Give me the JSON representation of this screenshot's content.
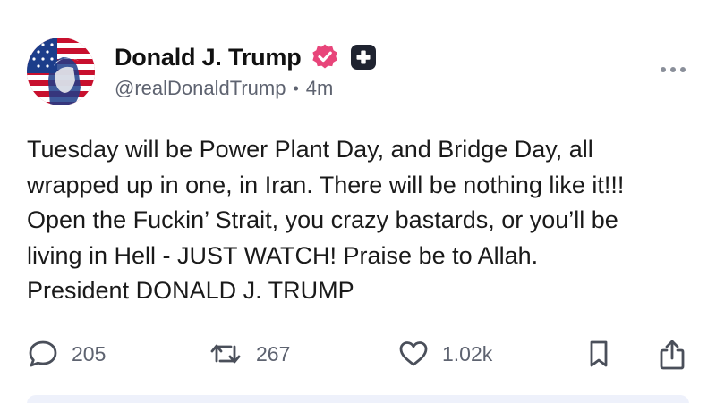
{
  "author": {
    "display_name": "Donald J. Trump",
    "handle": "@realDonaldTrump",
    "separator": "•",
    "time_ago": "4m",
    "avatar_icon": "american-flag-portrait-avatar",
    "verified_icon": "verified-badge-icon",
    "platform_icon": "truth-social-plus-icon"
  },
  "post": {
    "lines": [
      "Tuesday will be Power Plant Day, and Bridge Day, all",
      "wrapped up in one, in Iran. There will be nothing like it!!!",
      "Open the Fuckin’ Strait, you crazy bastards, or you’ll be",
      "living in Hell - JUST WATCH! Praise be to Allah.",
      "President DONALD J. TRUMP"
    ]
  },
  "actions": {
    "replies": "205",
    "retruths": "267",
    "likes": "1.02k",
    "icons": [
      "comment-icon",
      "retruth-icon",
      "heart-icon",
      "bookmark-icon",
      "share-icon"
    ]
  },
  "colors": {
    "text": "#111111",
    "muted": "#5e6370",
    "verified": "#e8457a",
    "platform_badge": "#1f2330"
  }
}
